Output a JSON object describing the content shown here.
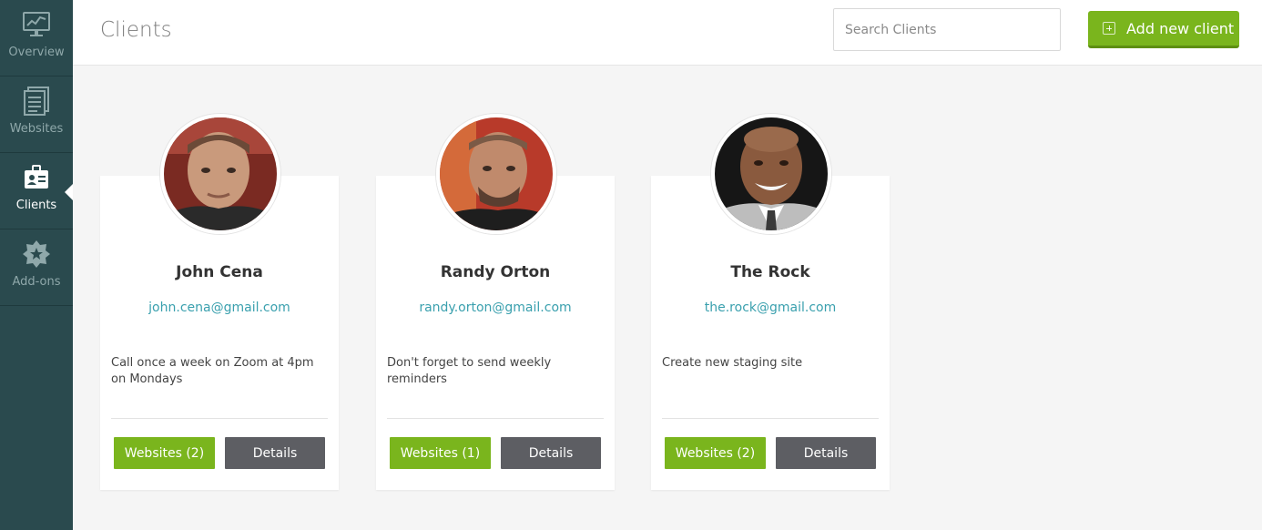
{
  "sidebar": {
    "items": [
      {
        "label": "Overview",
        "icon": "chart-monitor-icon",
        "active": false
      },
      {
        "label": "Websites",
        "icon": "pages-list-icon",
        "active": false
      },
      {
        "label": "Clients",
        "icon": "id-badge-icon",
        "active": true
      },
      {
        "label": "Add-ons",
        "icon": "gear-star-icon",
        "active": false
      }
    ]
  },
  "header": {
    "title": "Clients",
    "search_placeholder": "Search Clients",
    "add_button_label": "Add new client"
  },
  "clients": [
    {
      "name": "John Cena",
      "email": "john.cena@gmail.com",
      "note": "Call once a week on Zoom at 4pm on Mondays",
      "websites_label": "Websites (2)",
      "details_label": "Details"
    },
    {
      "name": "Randy Orton",
      "email": "randy.orton@gmail.com",
      "note": "Don't forget to send weekly reminders",
      "websites_label": "Websites (1)",
      "details_label": "Details"
    },
    {
      "name": "The Rock",
      "email": "the.rock@gmail.com",
      "note": "Create new staging site",
      "websites_label": "Websites (2)",
      "details_label": "Details"
    }
  ],
  "colors": {
    "sidebar_bg": "#2a4a4e",
    "accent_green": "#7ab51d",
    "details_gray": "#5d5e63",
    "email_link": "#3aa0ae"
  }
}
